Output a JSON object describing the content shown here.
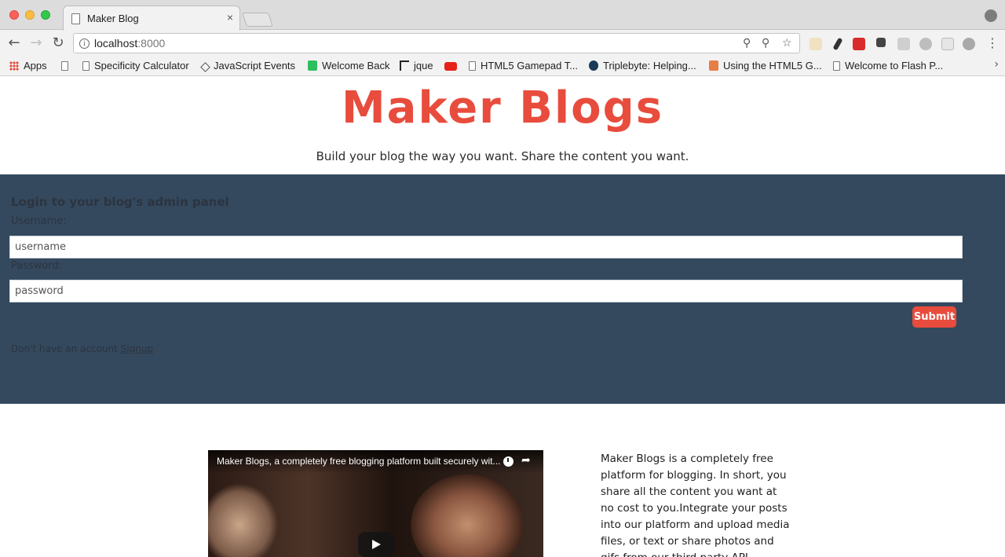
{
  "browser": {
    "tab_title": "Maker Blog",
    "tab_close": "×",
    "url_host": "localhost",
    "url_port": ":8000",
    "bookmarks": [
      {
        "label": "Apps",
        "icon": "apps-grid-icon"
      },
      {
        "label": "",
        "icon": "page-icon"
      },
      {
        "label": "Specificity Calculator",
        "icon": "page-icon"
      },
      {
        "label": "JavaScript Events",
        "icon": "diamond-icon"
      },
      {
        "label": "Welcome Back",
        "icon": "evernote-icon"
      },
      {
        "label": "jque",
        "icon": "jquery-icon"
      },
      {
        "label": "",
        "icon": "youtube-icon"
      },
      {
        "label": "HTML5 Gamepad T...",
        "icon": "page-icon"
      },
      {
        "label": "Triplebyte: Helping...",
        "icon": "triplebyte-icon"
      },
      {
        "label": "Using the HTML5 G...",
        "icon": "plus-icon"
      },
      {
        "label": "Welcome to Flash P...",
        "icon": "page-icon"
      }
    ],
    "colors": {
      "tabstrip": "#dcdcdc",
      "toolbar": "#f2f2f2"
    }
  },
  "header": {
    "title": "Maker Blogs",
    "tagline": "Build your blog the way you want. Share the content you want."
  },
  "login": {
    "heading": "Login to your blog's admin panel",
    "username_label": "Username:",
    "username_placeholder": "username",
    "password_label": "Password:",
    "password_placeholder": "password",
    "submit_label": "Submit",
    "signup_prompt": "Don't have an account",
    "signup_link": "Signup"
  },
  "video": {
    "title": "Maker Blogs, a completely free blogging platform built securely wit..."
  },
  "about": {
    "text": "Maker Blogs is a completely free platform for blogging. In short, you share all the content you want at no cost to you.Integrate your posts into our platform and upload media files, or text or share photos and gifs from our third party API integrations. Help"
  },
  "colors": {
    "brand": "#e84c3d",
    "panel": "#34495e"
  }
}
